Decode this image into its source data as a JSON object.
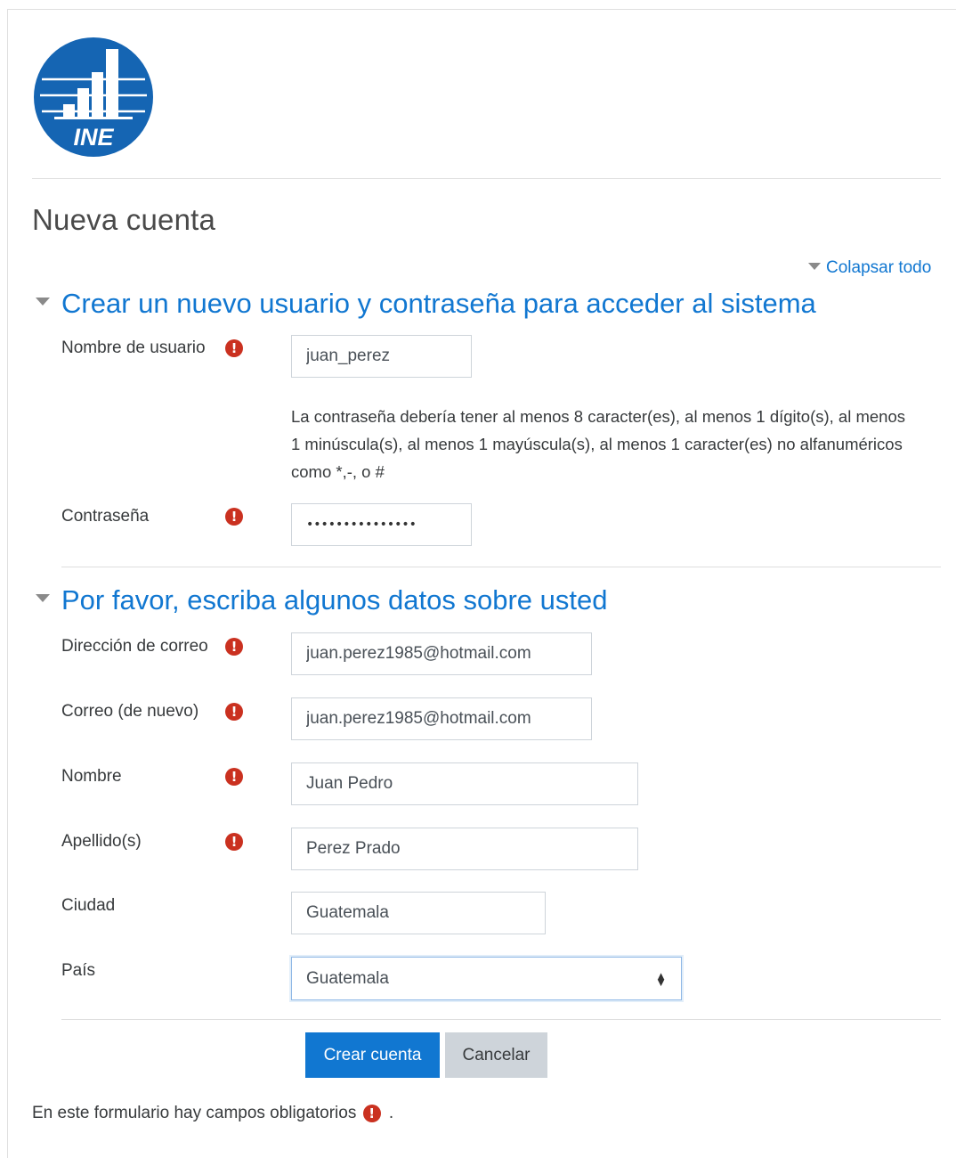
{
  "logo": {
    "text": "INE",
    "color": "#1565b3"
  },
  "page": {
    "title": "Nueva cuenta"
  },
  "collapse_all": {
    "label": "Colapsar todo",
    "icon": "caret-down-icon"
  },
  "sections": {
    "account": {
      "title": "Crear un nuevo usuario y contraseña para acceder al sistema"
    },
    "details": {
      "title": "Por favor, escriba algunos datos sobre usted"
    }
  },
  "fields": {
    "username": {
      "label": "Nombre de usuario",
      "value": "juan_perez",
      "required": true
    },
    "password_policy": "La contraseña debería tener al menos 8 caracter(es), al menos 1 dígito(s), al menos 1 minúscula(s), al menos 1 mayúscula(s), al menos 1 caracter(es) no alfanuméricos como *,-, o #",
    "password": {
      "label": "Contraseña",
      "value": "•••••••••••••••",
      "required": true
    },
    "email": {
      "label": "Dirección de correo",
      "value": "juan.perez1985@hotmail.com",
      "required": true
    },
    "email2": {
      "label": "Correo (de nuevo)",
      "value": "juan.perez1985@hotmail.com",
      "required": true
    },
    "firstname": {
      "label": "Nombre",
      "value": "Juan Pedro",
      "required": true
    },
    "lastname": {
      "label": "Apellido(s)",
      "value": "Perez Prado",
      "required": true
    },
    "city": {
      "label": "Ciudad",
      "value": "Guatemala"
    },
    "country": {
      "label": "País",
      "value": "Guatemala"
    }
  },
  "required_icon": "!",
  "buttons": {
    "submit": "Crear cuenta",
    "cancel": "Cancelar"
  },
  "footnote": {
    "text": "En este formulario hay campos obligatorios",
    "suffix": "."
  },
  "colors": {
    "link": "#1177d1",
    "required": "#ca3120",
    "button_primary": "#1177d1",
    "button_secondary": "#ced4da"
  }
}
